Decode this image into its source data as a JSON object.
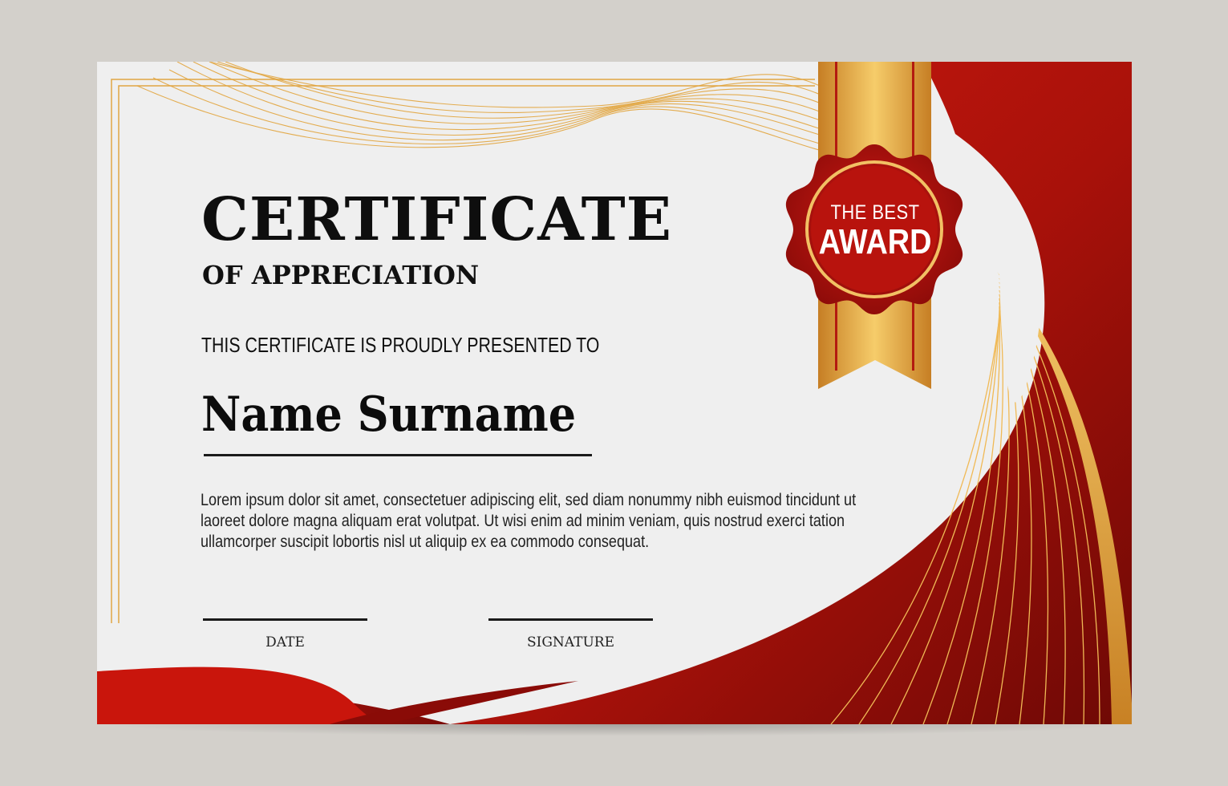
{
  "certificate": {
    "title": "CERTIFICATE",
    "subtitle": "OF APPRECIATION",
    "presented_line": "THIS CERTIFICATE IS PROUDLY PRESENTED TO",
    "recipient_name": "Name Surname",
    "body_text": "Lorem ipsum dolor sit amet, consectetuer adipiscing elit, sed diam nonummy nibh euismod tincidunt ut laoreet dolore magna aliquam erat volutpat. Ut wisi enim ad minim veniam, quis nostrud exerci tation ullamcorper suscipit lobortis nisl ut aliquip ex ea commodo consequat.",
    "date_label": "DATE",
    "signature_label": "SIGNATURE"
  },
  "seal": {
    "line1": "THE BEST",
    "line2": "AWARD"
  },
  "colors": {
    "background": "#d3d0cb",
    "paper": "#efefef",
    "accent_red": "#b3140c",
    "dark_red": "#7d0a06",
    "gold": "#e2a53e",
    "text": "#0e0e0e"
  }
}
